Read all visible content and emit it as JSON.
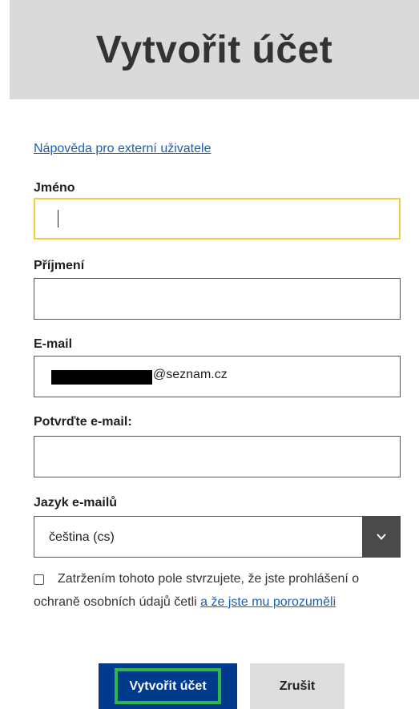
{
  "header": {
    "title": "Vytvořit účet"
  },
  "help_link": "Nápověda pro externí uživatele",
  "form": {
    "first_name": {
      "label": "Jméno",
      "value": ""
    },
    "last_name": {
      "label": "Příjmení",
      "value": ""
    },
    "email": {
      "label": "E-mail",
      "value_suffix": "@seznam.cz"
    },
    "confirm_email": {
      "label": "Potvrďte e-mail:",
      "value": ""
    },
    "language": {
      "label": "Jazyk e-mailů",
      "selected": "čeština (cs)"
    }
  },
  "consent": {
    "checked": false,
    "text": "Zatržením tohoto pole stvrzujete, že jste prohlášení o ochraně osobních údajů četli",
    "link": "a že jste mu porozuměli"
  },
  "buttons": {
    "create": "Vytvořit účet",
    "cancel": "Zrušit"
  },
  "colors": {
    "header_bg": "#dadada",
    "link": "#1a5fb4",
    "primary": "#003a8c",
    "focus_ring": "#2eb84a",
    "input_focus": "#f2cf3d",
    "select_button": "#4a4a4a"
  },
  "icons": {
    "select": "chevron-down-icon"
  }
}
